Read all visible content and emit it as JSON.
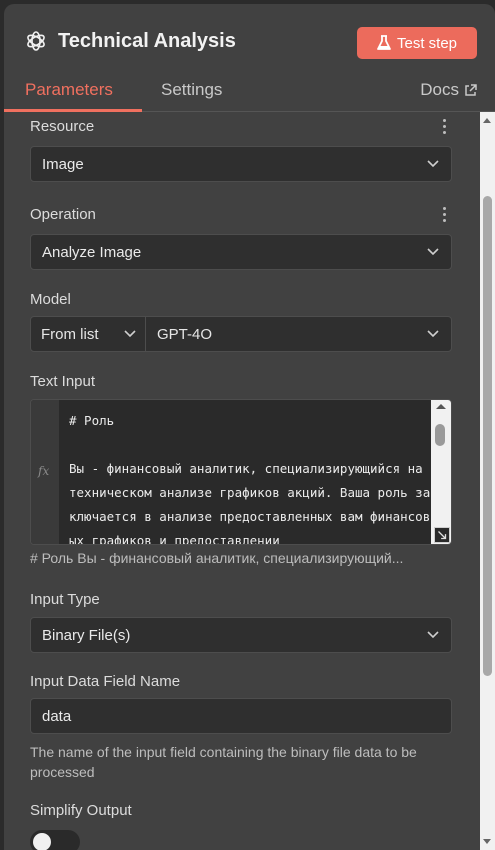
{
  "header": {
    "title": "Technical Analysis",
    "test_step_label": "Test step",
    "accent_color": "#ec6b5c"
  },
  "tabs": [
    {
      "label": "Parameters",
      "active": true
    },
    {
      "label": "Settings",
      "active": false
    }
  ],
  "docs_label": "Docs",
  "fields": {
    "resource": {
      "label": "Resource",
      "value": "Image"
    },
    "operation": {
      "label": "Operation",
      "value": "Analyze Image"
    },
    "model": {
      "label": "Model",
      "mode": "From list",
      "value": "GPT-4O"
    },
    "text_input": {
      "label": "Text Input",
      "code": "# Роль\n\nВы - финансовый аналитик, специализирующийся на техническом анализе графиков акций. Ваша роль заключается в анализе предоставленных вам финансовых графиков и предоставлении",
      "preview": "# Роль Вы - финансовый аналитик, специализирующий..."
    },
    "input_type": {
      "label": "Input Type",
      "value": "Binary File(s)"
    },
    "input_data_field": {
      "label": "Input Data Field Name",
      "value": "data",
      "hint": "The name of the input field containing the binary file data to be processed"
    },
    "simplify_output": {
      "label": "Simplify Output",
      "enabled": false
    }
  },
  "icons": {
    "app": "openai-logo-icon",
    "test": "flask-icon",
    "docs": "external-link-icon"
  }
}
